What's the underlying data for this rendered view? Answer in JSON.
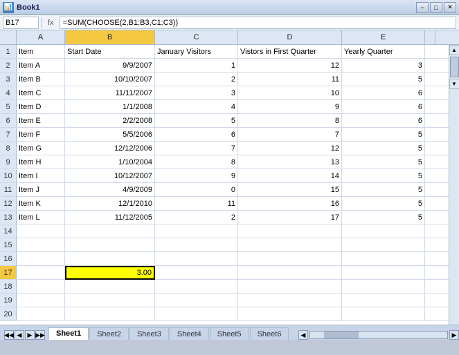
{
  "titlebar": {
    "text": "Book1",
    "min": "−",
    "max": "□",
    "close": "✕"
  },
  "formulabar": {
    "cellref": "B17",
    "formula": "=SUM(CHOOSE(2,B1:B3,C1:C3))"
  },
  "columns": [
    {
      "id": "a",
      "label": "A"
    },
    {
      "id": "b",
      "label": "B"
    },
    {
      "id": "c",
      "label": "C"
    },
    {
      "id": "d",
      "label": "D"
    },
    {
      "id": "e",
      "label": "E"
    }
  ],
  "rows": [
    {
      "num": 1,
      "cells": [
        "Item",
        "Start Date",
        "January Visitors",
        "Vistors in First Quarter",
        "Yearly Quarter"
      ]
    },
    {
      "num": 2,
      "cells": [
        "Item A",
        "9/9/2007",
        "1",
        "12",
        "3"
      ]
    },
    {
      "num": 3,
      "cells": [
        "Item B",
        "10/10/2007",
        "2",
        "11",
        "5"
      ]
    },
    {
      "num": 4,
      "cells": [
        "Item C",
        "11/11/2007",
        "3",
        "10",
        "6"
      ]
    },
    {
      "num": 5,
      "cells": [
        "Item D",
        "1/1/2008",
        "4",
        "9",
        "6"
      ]
    },
    {
      "num": 6,
      "cells": [
        "Item E",
        "2/2/2008",
        "5",
        "8",
        "6"
      ]
    },
    {
      "num": 7,
      "cells": [
        "Item F",
        "5/5/2006",
        "6",
        "7",
        "5"
      ]
    },
    {
      "num": 8,
      "cells": [
        "Item G",
        "12/12/2006",
        "7",
        "12",
        "5"
      ]
    },
    {
      "num": 9,
      "cells": [
        "Item H",
        "1/10/2004",
        "8",
        "13",
        "5"
      ]
    },
    {
      "num": 10,
      "cells": [
        "Item I",
        "10/12/2007",
        "9",
        "14",
        "5"
      ]
    },
    {
      "num": 11,
      "cells": [
        "Item J",
        "4/9/2009",
        "0",
        "15",
        "5"
      ]
    },
    {
      "num": 12,
      "cells": [
        "Item K",
        "12/1/2010",
        "11",
        "16",
        "5"
      ]
    },
    {
      "num": 13,
      "cells": [
        "Item L",
        "11/12/2005",
        "2",
        "17",
        "5"
      ]
    },
    {
      "num": 14,
      "cells": [
        "",
        "",
        "",
        "",
        ""
      ]
    },
    {
      "num": 15,
      "cells": [
        "",
        "",
        "",
        "",
        ""
      ]
    },
    {
      "num": 16,
      "cells": [
        "",
        "",
        "",
        "",
        ""
      ]
    },
    {
      "num": 17,
      "cells": [
        "",
        "3.00",
        "",
        "",
        ""
      ]
    },
    {
      "num": 18,
      "cells": [
        "",
        "",
        "",
        "",
        ""
      ]
    },
    {
      "num": 19,
      "cells": [
        "",
        "",
        "",
        "",
        ""
      ]
    },
    {
      "num": 20,
      "cells": [
        "",
        "",
        "",
        "",
        ""
      ]
    }
  ],
  "sheets": [
    "Sheet1",
    "Sheet2",
    "Sheet3",
    "Sheet4",
    "Sheet5",
    "Sheet6"
  ],
  "active_sheet": "Sheet1",
  "status": ""
}
